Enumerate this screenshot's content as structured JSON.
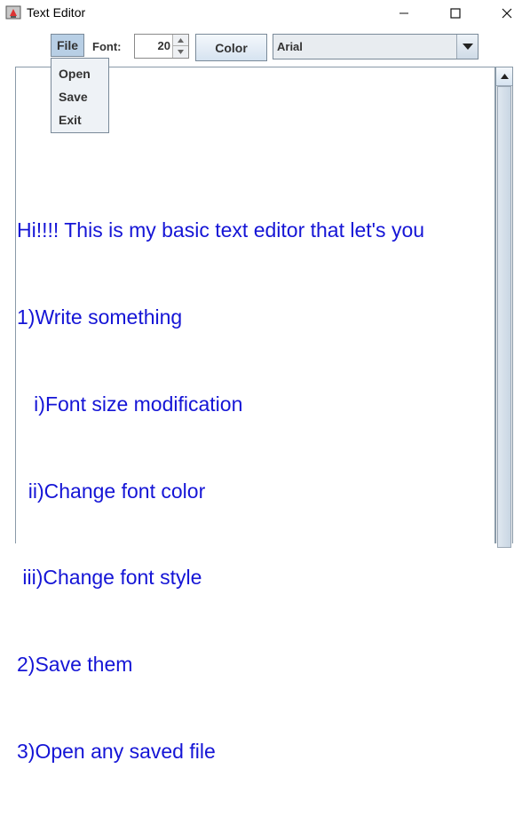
{
  "window": {
    "title": "Text Editor",
    "icons": {
      "app": "java-app-icon",
      "minimize": "minimize-icon",
      "maximize": "maximize-icon",
      "close": "close-icon"
    }
  },
  "toolbar": {
    "file_menu_label": "File",
    "font_label": "Font:",
    "font_size_value": "20",
    "color_button_label": "Color",
    "font_family_selected": "Arial"
  },
  "file_menu": {
    "items": [
      {
        "label": "Open"
      },
      {
        "label": "Save"
      },
      {
        "label": "Exit"
      }
    ]
  },
  "editor": {
    "text_color": "#1515d6",
    "lines": [
      "Hi!!!! This is my basic text editor that let's you",
      "1)Write something",
      "   i)Font size modification",
      "  ii)Change font color",
      " iii)Change font style",
      "2)Save them",
      "3)Open any saved file"
    ]
  }
}
